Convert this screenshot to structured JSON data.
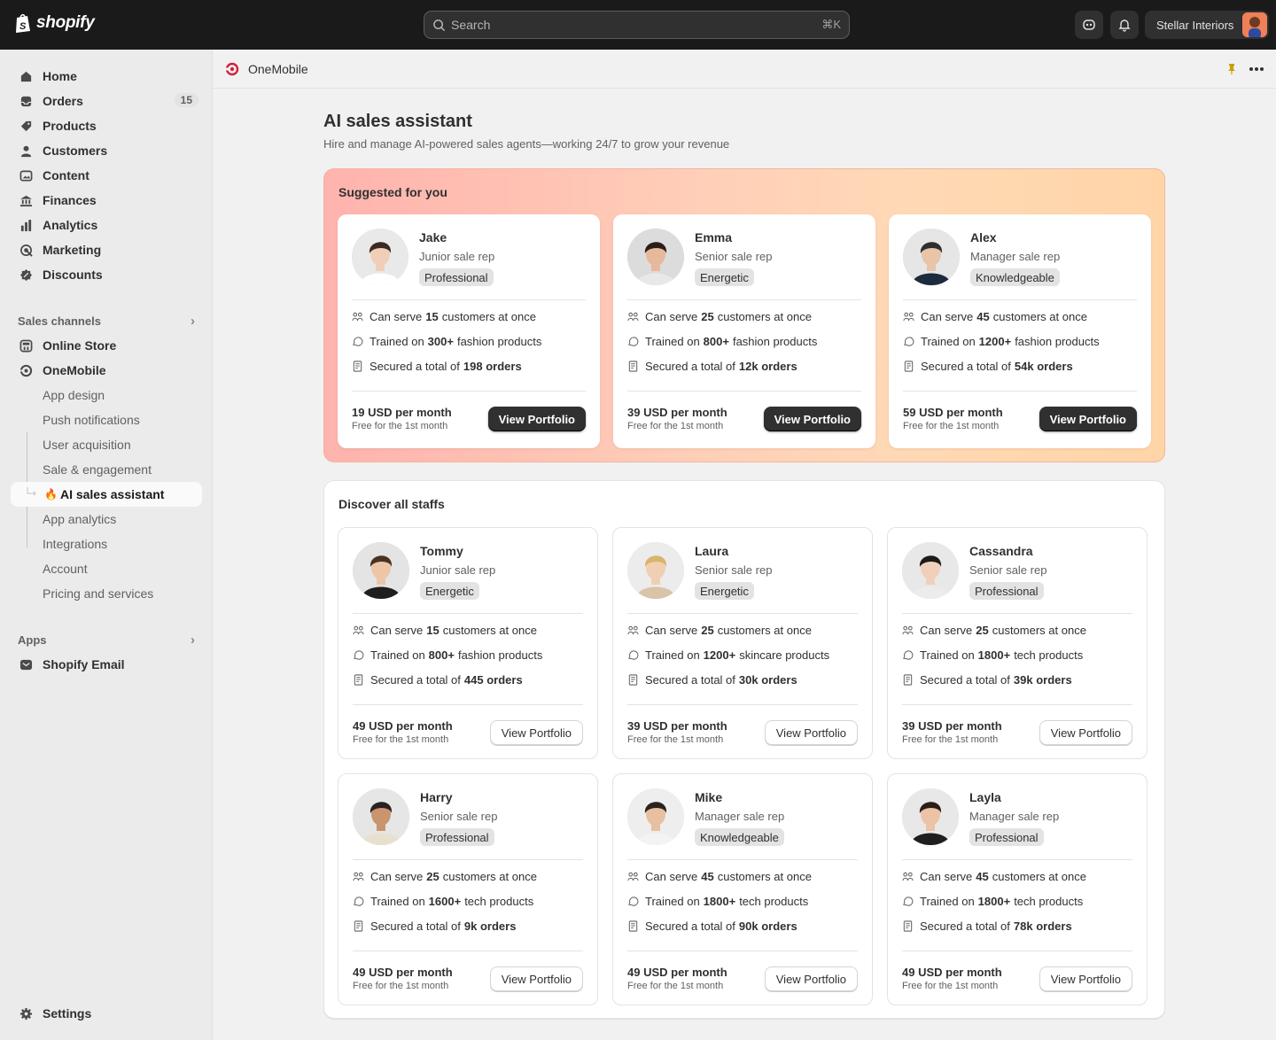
{
  "topbar": {
    "brand": "shopify",
    "search_placeholder": "Search",
    "search_shortcut": "⌘K",
    "store_name": "Stellar Interiors"
  },
  "sidebar": {
    "main": [
      {
        "label": "Home",
        "icon": "home-icon"
      },
      {
        "label": "Orders",
        "icon": "inbox-icon",
        "badge": "15"
      },
      {
        "label": "Products",
        "icon": "tag-icon"
      },
      {
        "label": "Customers",
        "icon": "person-icon"
      },
      {
        "label": "Content",
        "icon": "image-icon"
      },
      {
        "label": "Finances",
        "icon": "bank-icon"
      },
      {
        "label": "Analytics",
        "icon": "bar-chart-icon"
      },
      {
        "label": "Marketing",
        "icon": "target-icon"
      },
      {
        "label": "Discounts",
        "icon": "discount-icon"
      }
    ],
    "sales_channels_label": "Sales channels",
    "channels": [
      {
        "label": "Online Store"
      },
      {
        "label": "OneMobile"
      }
    ],
    "onemobile_items": [
      "App design",
      "Push notifications",
      "User acquisition",
      "Sale & engagement",
      "AI sales assistant",
      "App analytics",
      "Integrations",
      "Account",
      "Pricing and services"
    ],
    "active_emoji": "🔥",
    "apps_label": "Apps",
    "apps": [
      {
        "label": "Shopify Email"
      }
    ],
    "settings_label": "Settings"
  },
  "app_header": {
    "title": "OneMobile"
  },
  "page": {
    "title": "AI sales assistant",
    "subtitle": "Hire and manage AI-powered sales agents—working 24/7 to grow your revenue"
  },
  "suggested": {
    "title": "Suggested for you",
    "cards": [
      {
        "name": "Jake",
        "role": "Junior sale rep",
        "tag": "Professional",
        "serve_pre": "Can serve",
        "serve_num": "15",
        "serve_post": "customers at once",
        "train_pre": "Trained on",
        "train_num": "300+",
        "train_post": "fashion products",
        "secured_pre": "Secured a total of",
        "secured_num": "198 orders",
        "price": "19 USD per month",
        "free": "Free for the 1st month",
        "button": "View Portfolio"
      },
      {
        "name": "Emma",
        "role": "Senior sale rep",
        "tag": "Energetic",
        "serve_pre": "Can serve",
        "serve_num": "25",
        "serve_post": "customers at once",
        "train_pre": "Trained on",
        "train_num": "800+",
        "train_post": "fashion products",
        "secured_pre": "Secured a total of",
        "secured_num": "12k orders",
        "price": "39 USD per month",
        "free": "Free for the 1st month",
        "button": "View Portfolio"
      },
      {
        "name": "Alex",
        "role": "Manager sale rep",
        "tag": "Knowledgeable",
        "serve_pre": "Can serve",
        "serve_num": "45",
        "serve_post": "customers at once",
        "train_pre": "Trained on",
        "train_num": "1200+",
        "train_post": "fashion products",
        "secured_pre": "Secured a total of",
        "secured_num": "54k orders",
        "price": "59 USD per month",
        "free": "Free for the 1st month",
        "button": "View Portfolio"
      }
    ]
  },
  "discover": {
    "title": "Discover all staffs",
    "cards": [
      {
        "name": "Tommy",
        "role": "Junior sale rep",
        "tag": "Energetic",
        "serve_pre": "Can serve",
        "serve_num": "15",
        "serve_post": "customers at once",
        "train_pre": "Trained on",
        "train_num": "800+",
        "train_post": "fashion products",
        "secured_pre": "Secured a total of",
        "secured_num": "445 orders",
        "price": "49 USD per month",
        "free": "Free for the 1st month",
        "button": "View Portfolio"
      },
      {
        "name": "Laura",
        "role": "Senior sale rep",
        "tag": "Energetic",
        "serve_pre": "Can serve",
        "serve_num": "25",
        "serve_post": "customers at once",
        "train_pre": "Trained on",
        "train_num": "1200+",
        "train_post": "skincare products",
        "secured_pre": "Secured a total of",
        "secured_num": "30k orders",
        "price": "39 USD per month",
        "free": "Free for the 1st month",
        "button": "View Portfolio"
      },
      {
        "name": "Cassandra",
        "role": "Senior sale rep",
        "tag": "Professional",
        "serve_pre": "Can serve",
        "serve_num": "25",
        "serve_post": "customers at once",
        "train_pre": "Trained on",
        "train_num": "1800+",
        "train_post": "tech products",
        "secured_pre": "Secured a total of",
        "secured_num": "39k orders",
        "price": "39 USD per month",
        "free": "Free for the 1st month",
        "button": "View Portfolio"
      },
      {
        "name": "Harry",
        "role": "Senior sale rep",
        "tag": "Professional",
        "serve_pre": "Can serve",
        "serve_num": "25",
        "serve_post": "customers at once",
        "train_pre": "Trained on",
        "train_num": "1600+",
        "train_post": "tech products",
        "secured_pre": "Secured a total of",
        "secured_num": "9k orders",
        "price": "49 USD per month",
        "free": "Free for the 1st month",
        "button": "View Portfolio"
      },
      {
        "name": "Mike",
        "role": "Manager sale rep",
        "tag": "Knowledgeable",
        "serve_pre": "Can serve",
        "serve_num": "45",
        "serve_post": "customers at once",
        "train_pre": "Trained on",
        "train_num": "1800+",
        "train_post": "tech products",
        "secured_pre": "Secured a total of",
        "secured_num": "90k orders",
        "price": "49 USD per month",
        "free": "Free for the 1st month",
        "button": "View Portfolio"
      },
      {
        "name": "Layla",
        "role": "Manager sale rep",
        "tag": "Professional",
        "serve_pre": "Can serve",
        "serve_num": "45",
        "serve_post": "customers at once",
        "train_pre": "Trained on",
        "train_num": "1800+",
        "train_post": "tech products",
        "secured_pre": "Secured a total of",
        "secured_num": "78k orders",
        "price": "49 USD per month",
        "free": "Free for the 1st month",
        "button": "View Portfolio"
      }
    ]
  },
  "colors": {
    "topbar": "#1a1a1a",
    "accent_dark_button": "#303030",
    "suggest_gradient_start": "#ffb3ae",
    "suggest_gradient_end": "#ffd5a8",
    "onemobile_brand": "#d1233a"
  }
}
